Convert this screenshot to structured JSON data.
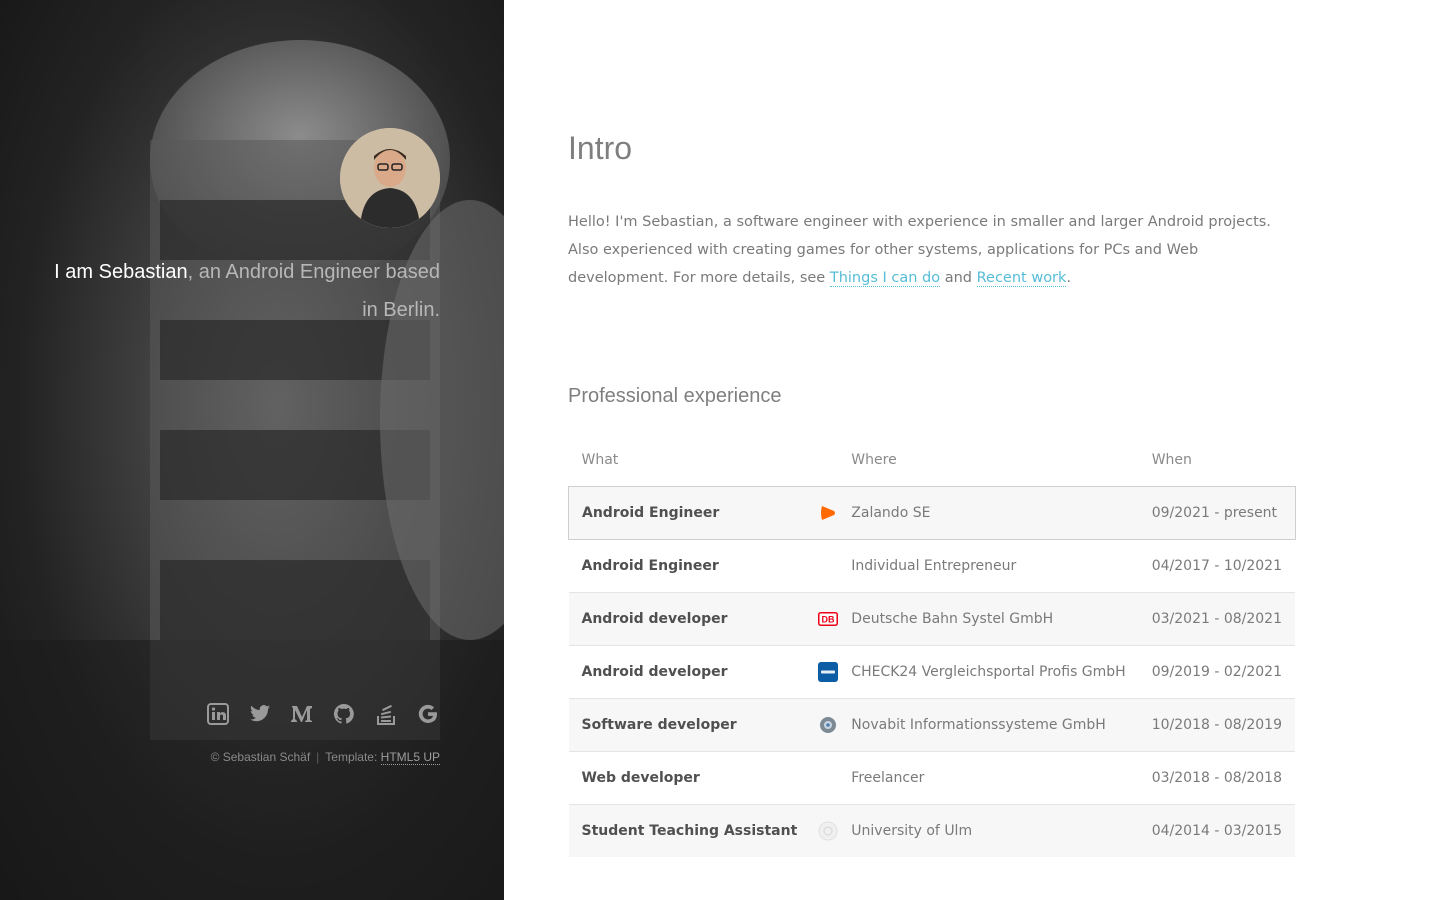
{
  "sidebar": {
    "tagline_name": "I am Sebastian",
    "tagline_rest": ", an Android Engineer based in Berlin.",
    "social_icons": [
      "linkedin-icon",
      "twitter-icon",
      "medium-icon",
      "github-icon",
      "stackoverflow-icon",
      "google-icon"
    ],
    "copyright": "© Sebastian Schäf",
    "template_label": "Template:",
    "template_link": "HTML5 UP"
  },
  "intro": {
    "title": "Intro",
    "text_before": "Hello! I'm Sebastian, a software engineer with experience in smaller and larger Android projects. Also experienced with creating games for other systems, applications for PCs and Web development. For more details, see ",
    "link1": "Things I can do",
    "between": " and ",
    "link2": "Recent work",
    "after": "."
  },
  "experience": {
    "title": "Professional experience",
    "headers": {
      "what": "What",
      "where": "Where",
      "when": "When"
    },
    "rows": [
      {
        "what": "Android Engineer",
        "where": "Zalando SE",
        "when": "09/2021 - present",
        "logo": "zalando-logo-icon"
      },
      {
        "what": "Android Engineer",
        "where": "Individual Entrepreneur",
        "when": "04/2017 - 10/2021",
        "logo": ""
      },
      {
        "what": "Android developer",
        "where": "Deutsche Bahn Systel GmbH",
        "when": "03/2021 - 08/2021",
        "logo": "db-logo-icon"
      },
      {
        "what": "Android developer",
        "where": "CHECK24 Vergleichsportal Profis GmbH",
        "when": "09/2019 - 02/2021",
        "logo": "check24-logo-icon"
      },
      {
        "what": "Software developer",
        "where": "Novabit Informationssysteme GmbH",
        "when": "10/2018 - 08/2019",
        "logo": "novabit-logo-icon"
      },
      {
        "what": "Web developer",
        "where": "Freelancer",
        "when": "03/2018 - 08/2018",
        "logo": ""
      },
      {
        "what": "Student Teaching Assistant",
        "where": "University of Ulm",
        "when": "04/2014 - 03/2015",
        "logo": "ulm-logo-icon"
      }
    ]
  },
  "colors": {
    "link": "#56bdd6",
    "zalando": "#ff6900",
    "db": "#ec0016",
    "check24": "#0c5da5"
  }
}
